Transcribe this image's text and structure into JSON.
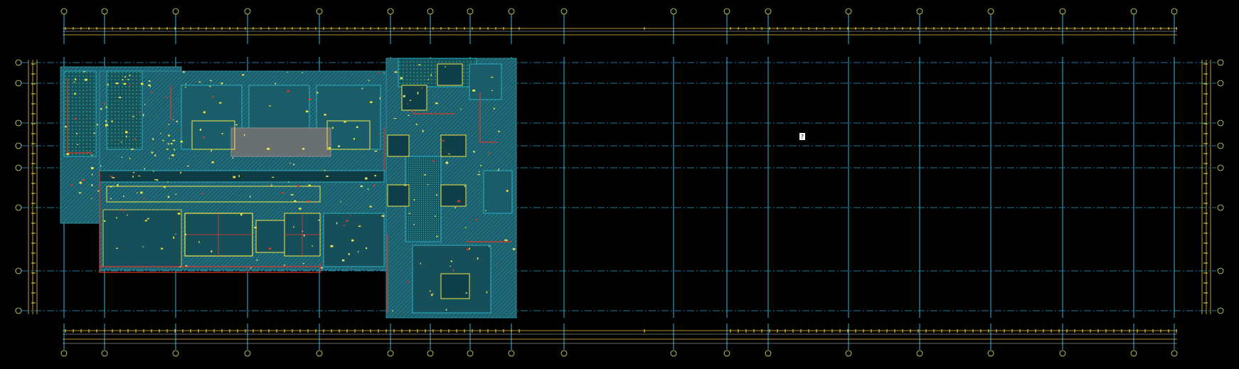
{
  "drawing": {
    "type": "architectural-floor-plan",
    "background": "#000000",
    "colors": {
      "grid_line": "#35b6e6",
      "dimension": "#e7c83a",
      "room_fill": "#1f6b78",
      "hatch": "#2c8fa0",
      "wall": "#e03a2a",
      "fixture": "#f2e64a",
      "annotation": "#cfd0d0"
    },
    "cursor_icon": "crosshair-cursor-icon",
    "tag_glyph": "?"
  }
}
